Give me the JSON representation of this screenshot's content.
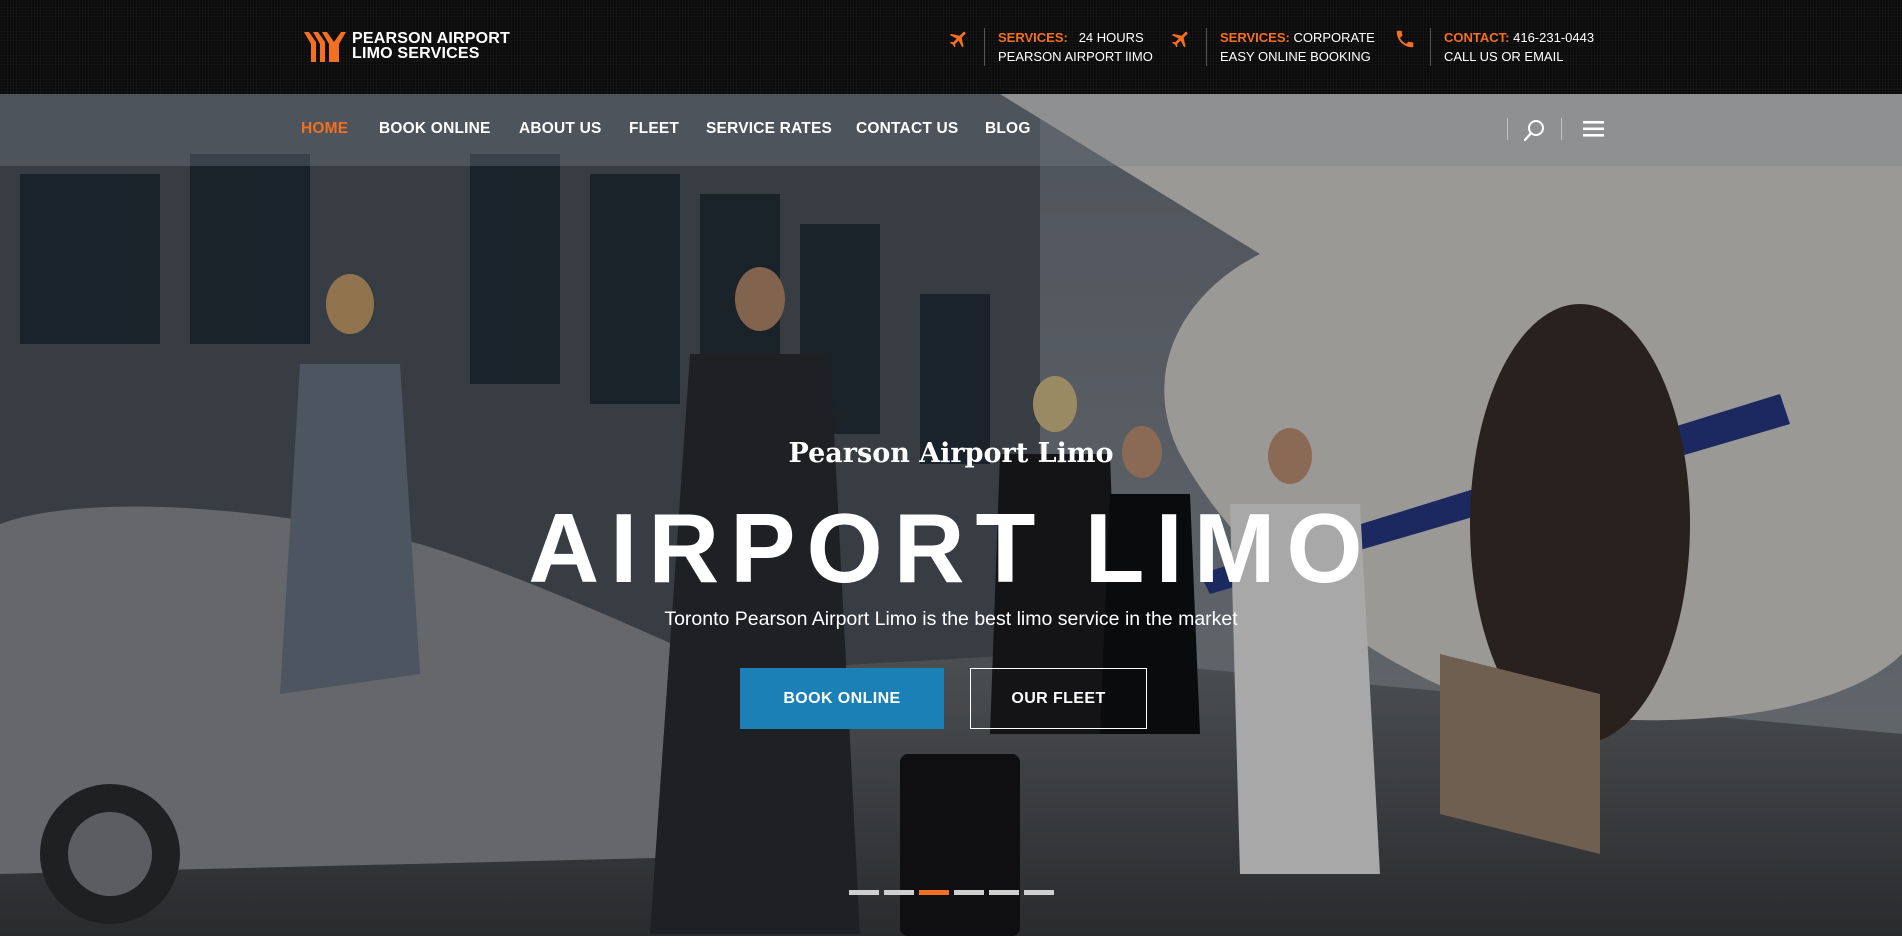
{
  "brand": {
    "line1": "PEARSON AIRPORT",
    "line2": "LIMO SERVICES",
    "accent": "#f36f21"
  },
  "topinfo": [
    {
      "icon": "airplane-icon",
      "label": "SERVICES:",
      "value": "24 HOURS",
      "line2": "PEARSON AIRPORT lIMO"
    },
    {
      "icon": "airplane-icon",
      "label": "SERVICES:",
      "value": "CORPORATE",
      "line2": "EASY ONLINE BOOKING"
    },
    {
      "icon": "phone-icon",
      "label": "CONTACT:",
      "value": "416-231-0443",
      "line2": "CALL US OR EMAIL"
    }
  ],
  "nav": {
    "items": [
      {
        "label": "HOME",
        "active": true
      },
      {
        "label": "BOOK ONLINE"
      },
      {
        "label": "ABOUT US"
      },
      {
        "label": "FLEET"
      },
      {
        "label": "SERVICE RATES"
      },
      {
        "label": "CONTACT US"
      },
      {
        "label": "BLOG"
      }
    ],
    "icons": [
      "search-icon",
      "menu-icon"
    ]
  },
  "hero": {
    "subtitle": "Pearson Airport Limo",
    "title": "AIRPORT LIMO",
    "tagline": "Toronto Pearson Airport Limo is the best limo service in the market",
    "primary_button": "BOOK ONLINE",
    "secondary_button": "OUR FLEET",
    "slides_total": 6,
    "slide_active": 3
  },
  "colors": {
    "accent": "#f36f21",
    "button_blue": "#1a80b6",
    "topbar": "#0b0b0b"
  }
}
